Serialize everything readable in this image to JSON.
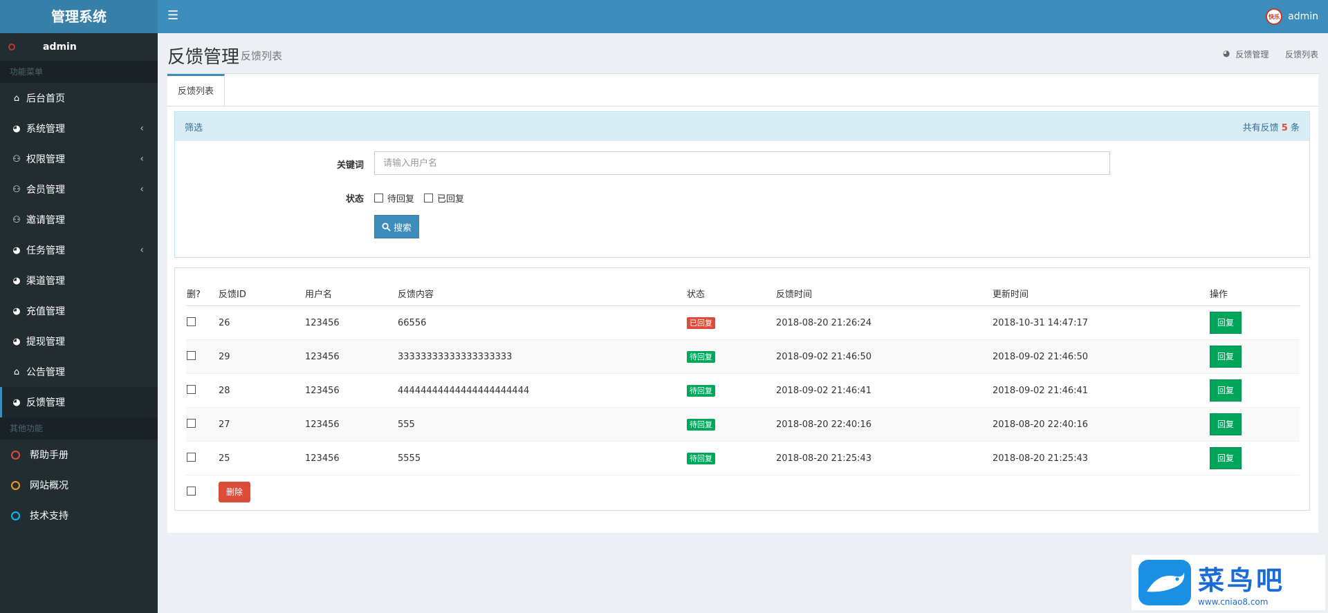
{
  "app": {
    "title": "管理系统"
  },
  "header": {
    "menu_icon": "☰",
    "username": "admin",
    "avatar_text": "快乐"
  },
  "sidebar": {
    "user": "admin",
    "section_main": "功能菜单",
    "items": [
      {
        "label": "后台首页",
        "icon": "home-icon",
        "glyph": "⌂",
        "chevron": ""
      },
      {
        "label": "系统管理",
        "icon": "dashboard-icon",
        "glyph": "◕",
        "chevron": "‹"
      },
      {
        "label": "权限管理",
        "icon": "users-icon",
        "glyph": "⚇",
        "chevron": "‹"
      },
      {
        "label": "会员管理",
        "icon": "users-icon",
        "glyph": "⚇",
        "chevron": "‹"
      },
      {
        "label": "邀请管理",
        "icon": "users-icon",
        "glyph": "⚇",
        "chevron": ""
      },
      {
        "label": "任务管理",
        "icon": "dashboard-icon",
        "glyph": "◕",
        "chevron": "‹"
      },
      {
        "label": "渠道管理",
        "icon": "dashboard-icon",
        "glyph": "◕",
        "chevron": ""
      },
      {
        "label": "充值管理",
        "icon": "dashboard-icon",
        "glyph": "◕",
        "chevron": ""
      },
      {
        "label": "提现管理",
        "icon": "dashboard-icon",
        "glyph": "◕",
        "chevron": ""
      },
      {
        "label": "公告管理",
        "icon": "home-icon",
        "glyph": "⌂",
        "chevron": ""
      },
      {
        "label": "反馈管理",
        "icon": "dashboard-icon",
        "glyph": "◕",
        "chevron": ""
      }
    ],
    "section_other": "其他功能",
    "other_items": [
      {
        "label": "帮助手册",
        "color": "#dd4b39"
      },
      {
        "label": "网站概况",
        "color": "#f39c12"
      },
      {
        "label": "技术支持",
        "color": "#00c0ef"
      }
    ]
  },
  "page": {
    "title": "反馈管理",
    "subtitle": "反馈列表",
    "breadcrumb": [
      "反馈管理",
      "反馈列表"
    ]
  },
  "tabs": [
    "反馈列表"
  ],
  "filter": {
    "title": "筛选",
    "count_prefix": "共有反馈",
    "count": "5",
    "count_suffix": "条",
    "keyword_label": "关键词",
    "keyword_placeholder": "请输入用户名",
    "keyword_value": "",
    "status_label": "状态",
    "status_options": [
      "待回复",
      "已回复"
    ],
    "search_label": "搜索"
  },
  "table": {
    "headers": [
      "删?",
      "反馈ID",
      "用户名",
      "反馈内容",
      "状态",
      "反馈时间",
      "更新时间",
      "操作"
    ],
    "rows": [
      {
        "id": "26",
        "user": "123456",
        "content": "66556",
        "status": "已回复",
        "status_color": "#dd4b39",
        "created": "2018-08-20 21:26:24",
        "updated": "2018-10-31 14:47:17",
        "action": "回复"
      },
      {
        "id": "29",
        "user": "123456",
        "content": "33333333333333333333",
        "status": "待回复",
        "status_color": "#00a65a",
        "created": "2018-09-02 21:46:50",
        "updated": "2018-09-02 21:46:50",
        "action": "回复"
      },
      {
        "id": "28",
        "user": "123456",
        "content": "44444444444444444444444",
        "status": "待回复",
        "status_color": "#00a65a",
        "created": "2018-09-02 21:46:41",
        "updated": "2018-09-02 21:46:41",
        "action": "回复"
      },
      {
        "id": "27",
        "user": "123456",
        "content": "555",
        "status": "待回复",
        "status_color": "#00a65a",
        "created": "2018-08-20 22:40:16",
        "updated": "2018-08-20 22:40:16",
        "action": "回复"
      },
      {
        "id": "25",
        "user": "123456",
        "content": "5555",
        "status": "待回复",
        "status_color": "#00a65a",
        "created": "2018-08-20 21:25:43",
        "updated": "2018-08-20 21:25:43",
        "action": "回复"
      }
    ],
    "delete_label": "删除"
  },
  "watermark": {
    "brand": "菜鸟吧",
    "url": "www.cniao8.com"
  }
}
